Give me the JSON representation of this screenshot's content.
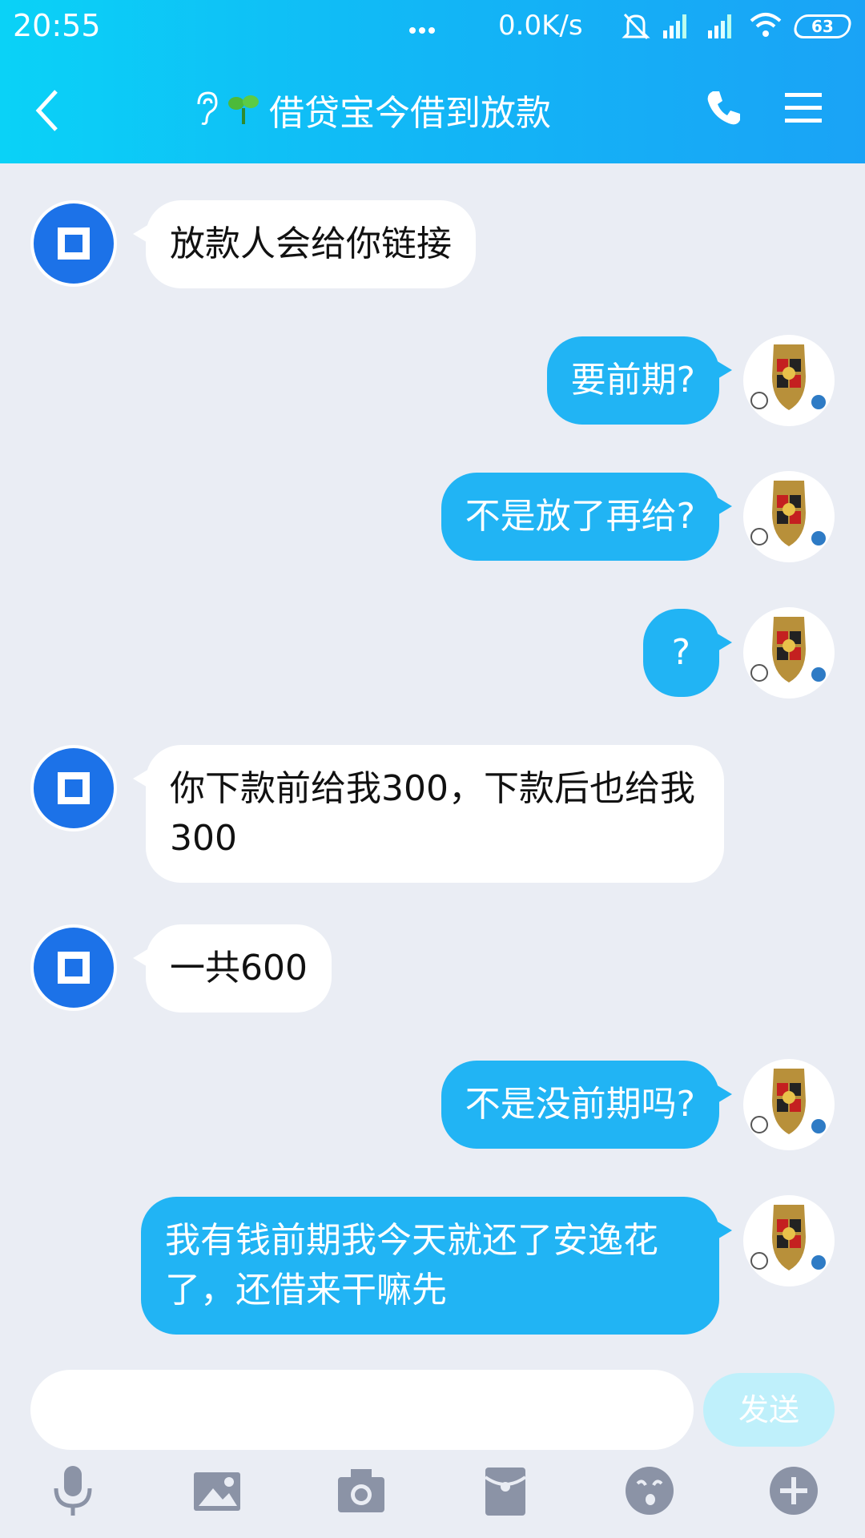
{
  "status": {
    "time": "20:55",
    "speed": "0.0K/s",
    "battery": "63"
  },
  "nav": {
    "title": "借贷宝今借到放款",
    "back_icon": "chevron-left-icon",
    "phone_icon": "phone-icon",
    "menu_icon": "menu-icon"
  },
  "messages": [
    {
      "side": "left",
      "text": "放款人会给你链接"
    },
    {
      "side": "right",
      "text": "要前期?"
    },
    {
      "side": "right",
      "text": "不是放了再给?"
    },
    {
      "side": "right",
      "text": "?"
    },
    {
      "side": "left",
      "text": "你下款前给我300，下款后也给我300"
    },
    {
      "side": "left",
      "text": "一共600"
    },
    {
      "side": "right",
      "text": "不是没前期吗?"
    },
    {
      "side": "right",
      "text": "我有钱前期我今天就还了安逸花了，还借来干嘛先"
    }
  ],
  "composer": {
    "send_label": "发送",
    "tools": [
      "microphone-icon",
      "image-icon",
      "camera-icon",
      "red-packet-icon",
      "emoji-icon",
      "plus-icon"
    ]
  },
  "colors": {
    "header_start": "#0ad2f7",
    "header_end": "#1aa3f6",
    "right_bubble": "#21b4f4",
    "left_avatar": "#1c72e8",
    "background": "#eaedf4"
  }
}
